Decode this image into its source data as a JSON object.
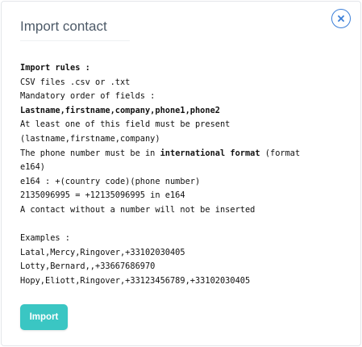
{
  "modal": {
    "title": "Import contact",
    "close_icon": "close-icon",
    "accent_color": "#3b7fd8"
  },
  "rules": {
    "heading": "Import rules :",
    "file_types": "CSV files .csv or .txt",
    "mandatory_order": "Mandatory order of fields :",
    "fields": "Lastname,firstname,company,phone1,phone2",
    "at_least_one": "At least one of this field must be present",
    "at_least_one_fields": "(lastname,firstname,company)",
    "phone_format_prefix": "The phone number must be in ",
    "phone_format_bold": "international format",
    "phone_format_suffix": " (format",
    "phone_format_e164": "e164)",
    "e164_pattern": "e164 : +(country code)(phone number)",
    "e164_example": "2135096995 = +12135096995 in e164",
    "no_number_note": "A contact without a number will not be inserted"
  },
  "examples": {
    "heading": "Examples :",
    "rows": [
      "Latal,Mercy,Ringover,+33102030405",
      "Lotty,Bernard,,+33667686970",
      "Hopy,Eliott,Ringover,+33123456789,+33102030405"
    ]
  },
  "actions": {
    "import_label": "Import",
    "import_color": "#3ac6c3"
  }
}
